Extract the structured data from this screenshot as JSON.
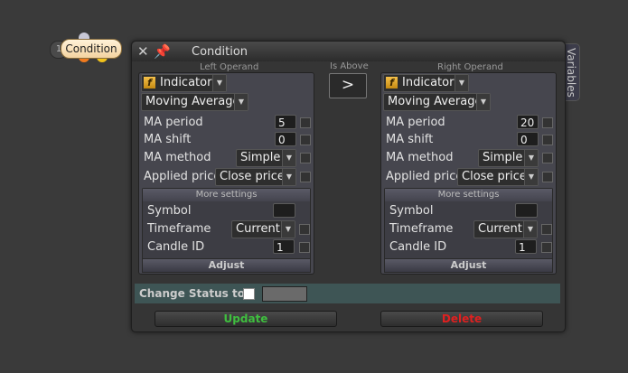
{
  "node": {
    "number": "1",
    "label": "Condition",
    "dot_colors": [
      "#f07a1e",
      "#f2c21b",
      "#c0c0d0"
    ]
  },
  "window": {
    "title": "Condition",
    "variables_tab": "Variables"
  },
  "operator": {
    "label": "Is Above",
    "symbol": ">"
  },
  "left": {
    "header": "Left Operand",
    "type": "Indicator",
    "indicator": "Moving Average",
    "params": [
      {
        "label": "MA period",
        "value": "5",
        "kind": "input"
      },
      {
        "label": "MA shift",
        "value": "0",
        "kind": "input"
      },
      {
        "label": "MA method",
        "value": "Simple",
        "kind": "select"
      },
      {
        "label": "Applied price",
        "value": "Close price",
        "kind": "select"
      }
    ],
    "more_settings": "More settings",
    "settings": [
      {
        "label": "Symbol",
        "value": "",
        "kind": "input"
      },
      {
        "label": "Timeframe",
        "value": "Current",
        "kind": "select"
      },
      {
        "label": "Candle ID",
        "value": "1",
        "kind": "input"
      }
    ],
    "adjust": "Adjust"
  },
  "right": {
    "header": "Right Operand",
    "type": "Indicator",
    "indicator": "Moving Average",
    "params": [
      {
        "label": "MA period",
        "value": "20",
        "kind": "input"
      },
      {
        "label": "MA shift",
        "value": "0",
        "kind": "input"
      },
      {
        "label": "MA method",
        "value": "Simple",
        "kind": "select"
      },
      {
        "label": "Applied price",
        "value": "Close price",
        "kind": "select"
      }
    ],
    "more_settings": "More settings",
    "settings": [
      {
        "label": "Symbol",
        "value": "",
        "kind": "input"
      },
      {
        "label": "Timeframe",
        "value": "Current",
        "kind": "select"
      },
      {
        "label": "Candle ID",
        "value": "1",
        "kind": "input"
      }
    ],
    "adjust": "Adjust"
  },
  "status": {
    "label": "Change Status to"
  },
  "buttons": {
    "update": "Update",
    "delete": "Delete",
    "update_color": "#3fbf3f",
    "delete_color": "#e02020"
  }
}
